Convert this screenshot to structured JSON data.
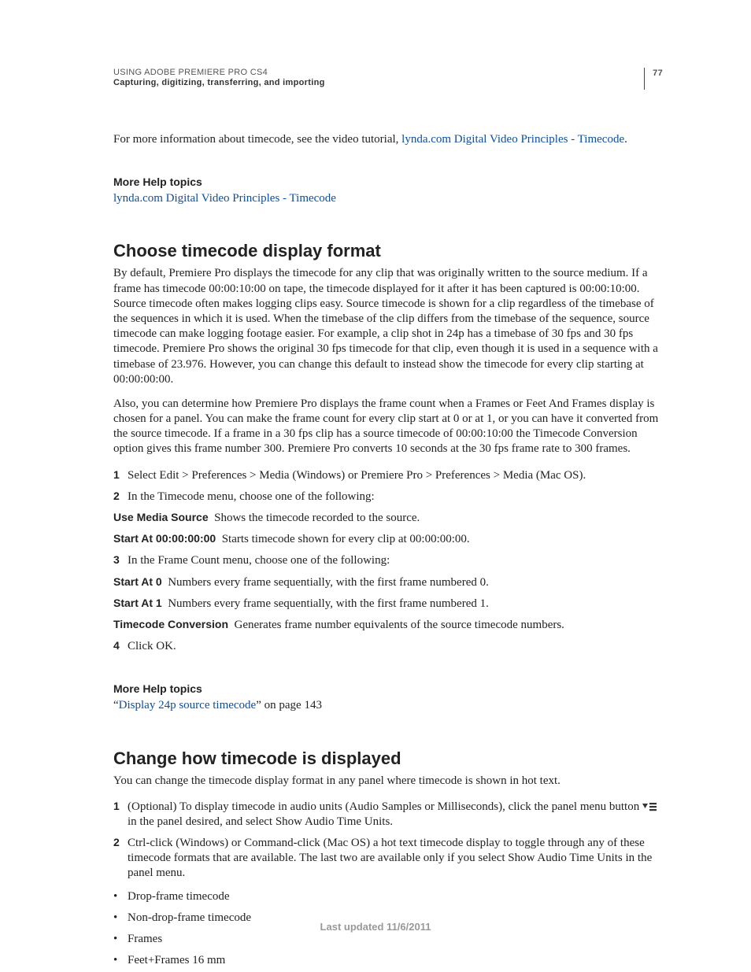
{
  "header": {
    "title": "USING ADOBE PREMIERE PRO CS4",
    "subtitle": "Capturing, digitizing, transferring, and importing",
    "page_number": "77"
  },
  "intro": {
    "pre": "For more information about timecode, see the video tutorial, ",
    "link": "lynda.com Digital Video Principles - Timecode",
    "post": "."
  },
  "more1": {
    "heading": "More Help topics",
    "link": "lynda.com Digital Video Principles - Timecode"
  },
  "section1": {
    "heading": "Choose timecode display format",
    "p1": "By default, Premiere Pro displays the timecode for any clip that was originally written to the source medium. If a frame has timecode 00:00:10:00 on tape, the timecode displayed for it after it has been captured is 00:00:10:00. Source timecode often makes logging clips easy. Source timecode is shown for a clip regardless of the timebase of the sequences in which it is used. When the timebase of the clip differs from the timebase of the sequence, source timecode can make logging footage easier. For example, a clip shot in 24p has a timebase of 30 fps and 30 fps timecode. Premiere Pro shows the original 30 fps timecode for that clip, even though it is used in a sequence with a timebase of 23.976. However, you can change this default to instead show the timecode for every clip starting at 00:00:00:00.",
    "p2": "Also, you can determine how Premiere Pro displays the frame count when a Frames or Feet And Frames display is chosen for a panel. You can make the frame count for every clip start at 0 or at 1, or you can have it converted from the source timecode. If a frame in a 30 fps clip has a source timecode of 00:00:10:00 the Timecode Conversion option gives this frame number 300. Premiere Pro converts 10 seconds at the 30 fps frame rate to 300 frames.",
    "step1": "Select Edit > Preferences > Media (Windows) or Premiere Pro > Preferences > Media (Mac OS).",
    "step2": "In the Timecode menu, choose one of the following:",
    "opt_a_label": "Use Media Source",
    "opt_a_desc": "Shows the timecode recorded to the source.",
    "opt_b_label": "Start At 00:00:00:00",
    "opt_b_desc": "Starts timecode shown for every clip at 00:00:00:00.",
    "step3": "In the Frame Count menu, choose one of the following:",
    "opt_c_label": "Start At 0",
    "opt_c_desc": "Numbers every frame sequentially, with the first frame numbered 0.",
    "opt_d_label": "Start At 1",
    "opt_d_desc": "Numbers every frame sequentially, with the first frame numbered 1.",
    "opt_e_label": "Timecode Conversion",
    "opt_e_desc": "Generates frame number equivalents of the source timecode numbers.",
    "step4": "Click OK."
  },
  "more2": {
    "heading": "More Help topics",
    "quote_open": "“",
    "link": "Display 24p source timecode",
    "quote_close": "” on page 143"
  },
  "section2": {
    "heading": "Change how timecode is displayed",
    "p1": "You can change the timecode display format in any panel where timecode is shown in hot text.",
    "step1a": "(Optional) To display timecode in audio units (Audio Samples or Milliseconds), click the panel menu button ",
    "step1b": " in the panel desired, and select Show Audio Time Units.",
    "step2": "Ctrl-click (Windows) or Command-click (Mac OS) a hot text timecode display to toggle through any of these timecode formats that are available. The last two are available only if you select Show Audio Time Units in the panel menu.",
    "b1": "Drop-frame timecode",
    "b2": "Non-drop-frame timecode",
    "b3": "Frames",
    "b4": "Feet+Frames 16 mm"
  },
  "footer": "Last updated 11/6/2011"
}
